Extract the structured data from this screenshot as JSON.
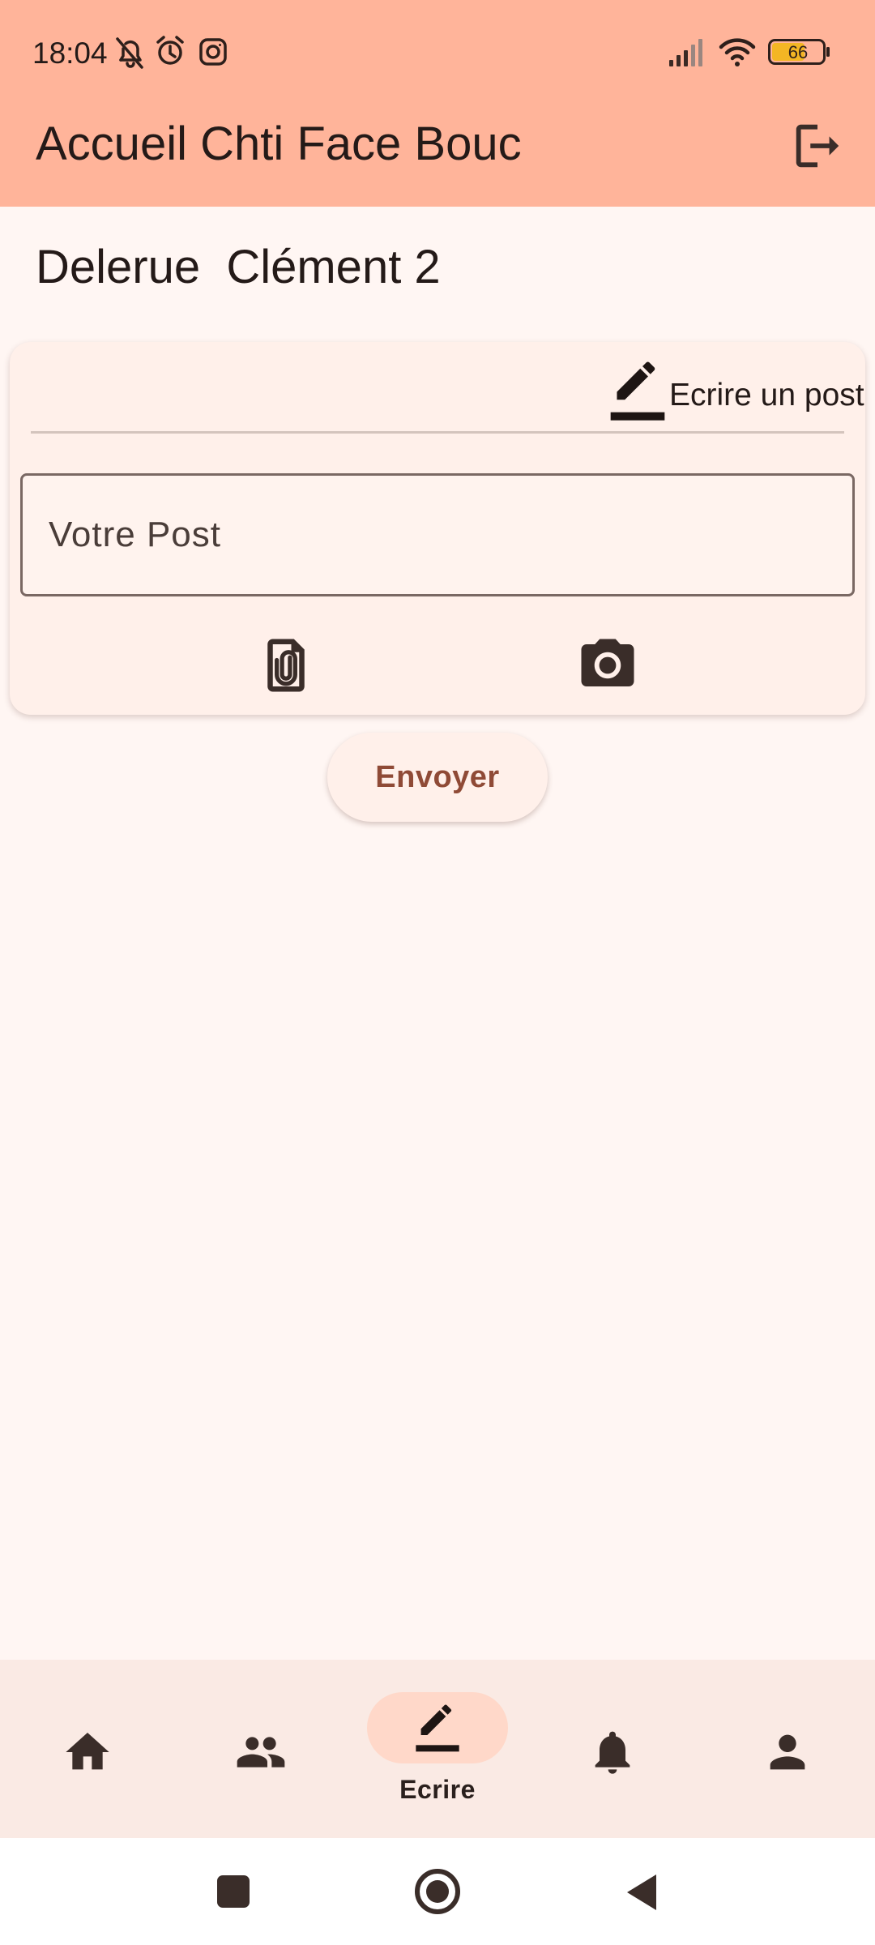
{
  "status_bar": {
    "time": "18:04",
    "battery": "66",
    "icons": [
      "bell-off-icon",
      "alarm-icon",
      "instagram-icon",
      "signal-icon",
      "wifi-icon",
      "battery-icon"
    ]
  },
  "app_bar": {
    "title": "Accueil Chti Face Bouc",
    "action_icon": "logout-icon"
  },
  "user": {
    "name": "Delerue  Clément 2"
  },
  "post_card": {
    "header_icon": "edit-icon",
    "header_label": "Ecrire un post",
    "input_placeholder": "Votre Post",
    "input_value": "",
    "attach_icon": "attach-file-icon",
    "camera_icon": "camera-icon"
  },
  "send_button": {
    "label": "Envoyer"
  },
  "bottom_nav": {
    "items": [
      {
        "icon": "home-icon",
        "label": ""
      },
      {
        "icon": "people-icon",
        "label": ""
      },
      {
        "icon": "edit-icon",
        "label": "Ecrire",
        "active": true
      },
      {
        "icon": "bell-icon",
        "label": ""
      },
      {
        "icon": "person-icon",
        "label": ""
      }
    ]
  },
  "system_nav": {
    "icons": [
      "recents-icon",
      "home-circle-icon",
      "back-icon"
    ]
  },
  "colors": {
    "app_bar": "#ffb49a",
    "background": "#fff6f3",
    "card": "#fff0ea",
    "accent_text": "#8f4a36",
    "nav_active": "#ffd8c9"
  }
}
